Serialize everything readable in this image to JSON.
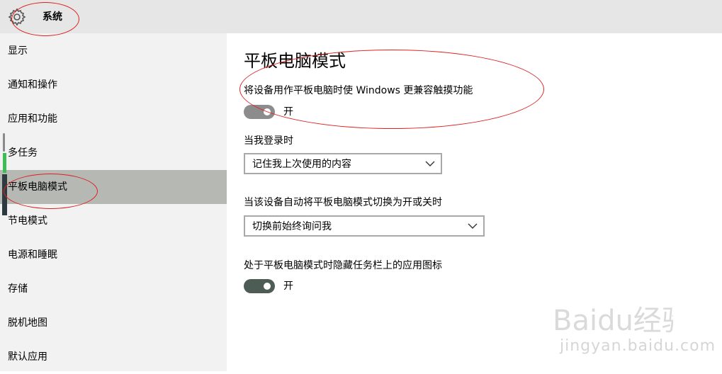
{
  "app": {
    "title": "系统"
  },
  "sidebar": {
    "items": [
      {
        "label": "显示"
      },
      {
        "label": "通知和操作"
      },
      {
        "label": "应用和功能"
      },
      {
        "label": "多任务"
      },
      {
        "label": "平板电脑模式",
        "selected": true
      },
      {
        "label": "节电模式"
      },
      {
        "label": "电源和睡眠"
      },
      {
        "label": "存储"
      },
      {
        "label": "脱机地图"
      },
      {
        "label": "默认应用"
      }
    ]
  },
  "main": {
    "title": "平板电脑模式",
    "touch_setting": {
      "label": "将设备用作平板电脑时使 Windows 更兼容触摸功能",
      "toggle_state": "开",
      "enabled": false
    },
    "signin_setting": {
      "label": "当我登录时",
      "selected": "记住我上次使用的内容"
    },
    "switch_setting": {
      "label": "当该设备自动将平板电脑模式切换为开或关时",
      "selected": "切换前始终询问我"
    },
    "taskbar_setting": {
      "label": "处于平板电脑模式时隐藏任务栏上的应用图标",
      "toggle_state": "开",
      "enabled": true
    }
  },
  "watermark": {
    "brand": "Baidu经验",
    "url": "jingyan.baidu.com"
  },
  "colors": {
    "selected_nav": "#b6b8b3",
    "toggle_on": "#4d5c55",
    "toggle_disabled": "#8c8c8c",
    "annotation": "#d22222"
  }
}
